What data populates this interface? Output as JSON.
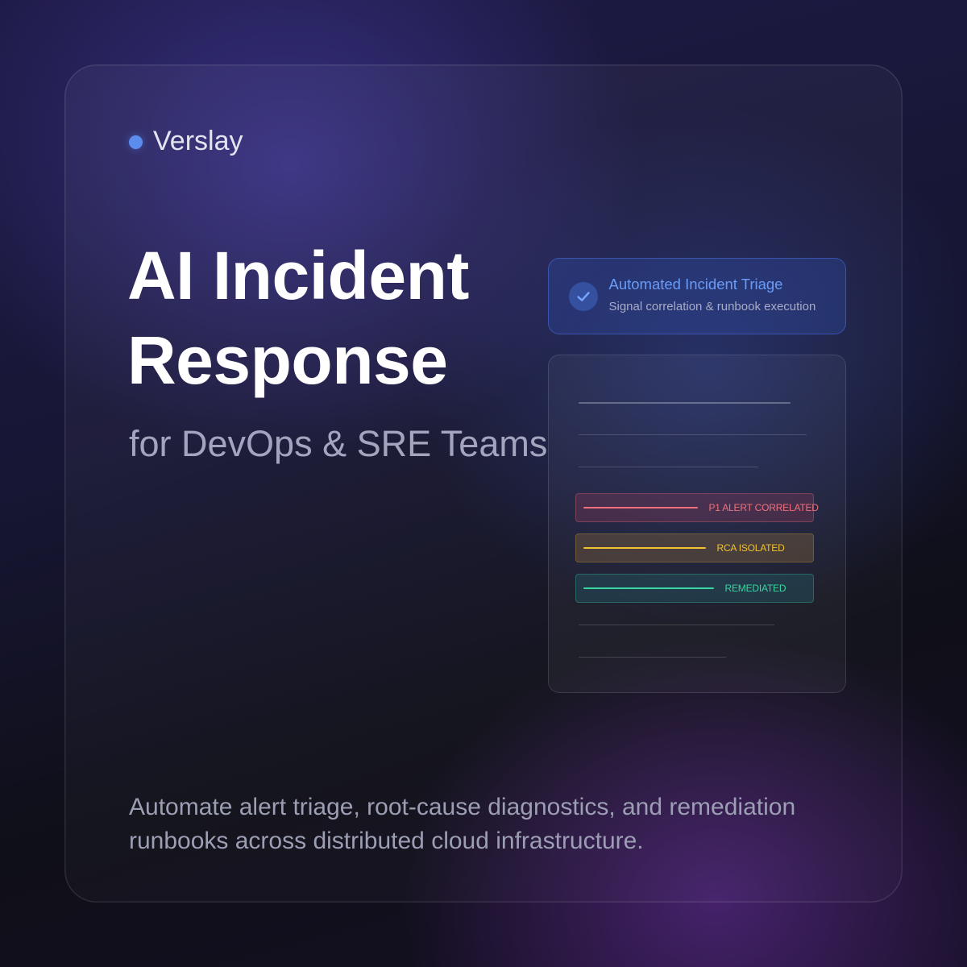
{
  "brand": {
    "name": "Verslay",
    "dot_color": "#5b8def"
  },
  "hero": {
    "title_line1": "AI Incident",
    "title_line2": "Response",
    "subtitle": "for DevOps & SRE Teams"
  },
  "triage_card": {
    "icon": "check-icon",
    "title": "Automated Incident Triage",
    "subtitle": "Signal correlation & runbook execution",
    "accent_color": "#6a9cf7"
  },
  "status_panel": {
    "rows": [
      {
        "label": "P1 ALERT CORRELATED",
        "color": "#f2707c"
      },
      {
        "label": "RCA ISOLATED",
        "color": "#f2c230"
      },
      {
        "label": "REMEDIATED",
        "color": "#38d6a0"
      }
    ]
  },
  "description_lines": [
    "Automate alert triage, root-cause diagnostics, and remediation",
    "runbooks across distributed cloud infrastructure."
  ]
}
